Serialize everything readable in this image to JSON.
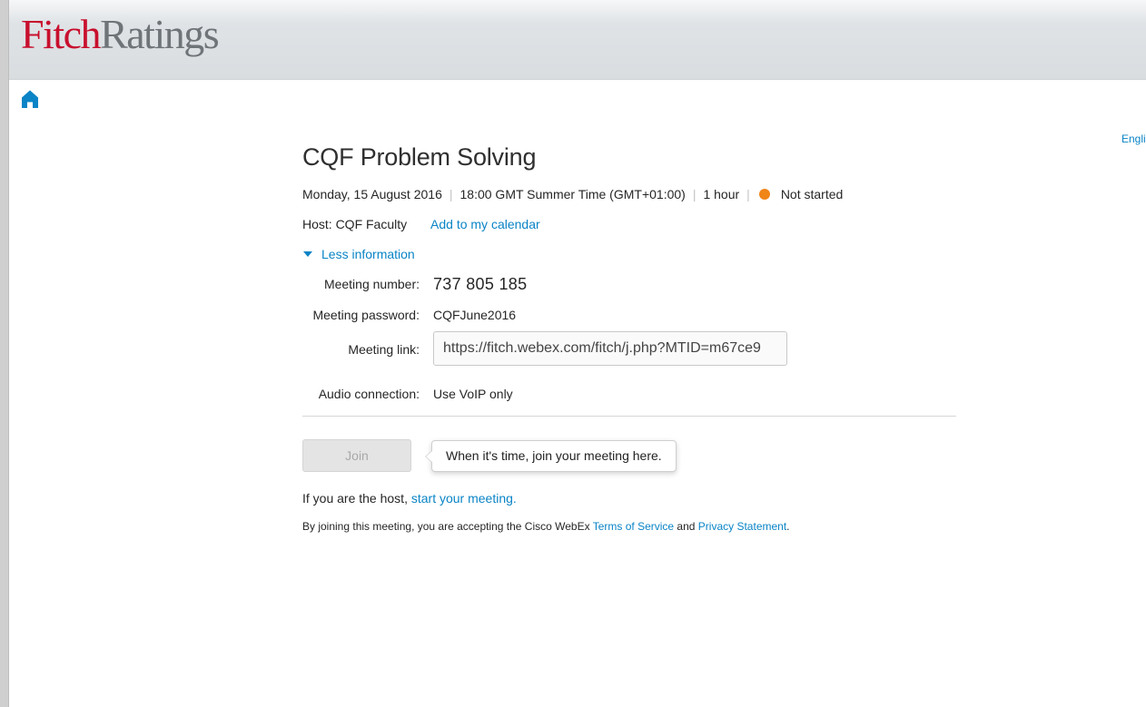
{
  "header": {
    "logo_part1": "Fitch",
    "logo_part2": "Ratings",
    "logo_color_primary": "#c8102e",
    "logo_color_secondary": "#6f7479"
  },
  "nav": {
    "home_icon": "home-icon",
    "language_label": "English"
  },
  "meeting": {
    "title": "CQF Problem Solving",
    "date": "Monday, 15 August 2016",
    "time": "18:00 GMT Summer Time (GMT+01:00)",
    "duration": "1 hour",
    "status": "Not started",
    "status_color": "#f08518",
    "host_label": "Host: CQF Faculty",
    "add_calendar_label": "Add to my calendar",
    "toggle_label": "Less information",
    "number_label": "Meeting number:",
    "number_value": "737 805 185",
    "password_label": "Meeting password:",
    "password_value": "CQFJune2016",
    "link_label": "Meeting link:",
    "link_value": "https://fitch.webex.com/fitch/j.php?MTID=m67ce9",
    "audio_label": "Audio connection:",
    "audio_value": "Use VoIP only"
  },
  "actions": {
    "join_label": "Join",
    "tooltip": "When it's time, join your meeting here.",
    "host_prefix": "If you are the host, ",
    "host_link": "start your meeting.",
    "terms_prefix": "By joining this meeting, you are accepting the Cisco WebEx ",
    "terms_link": "Terms of Service",
    "terms_and": " and ",
    "privacy_link": "Privacy Statement",
    "terms_suffix": "."
  },
  "colors": {
    "link": "#0a84c6",
    "accent_text": "#262626"
  }
}
